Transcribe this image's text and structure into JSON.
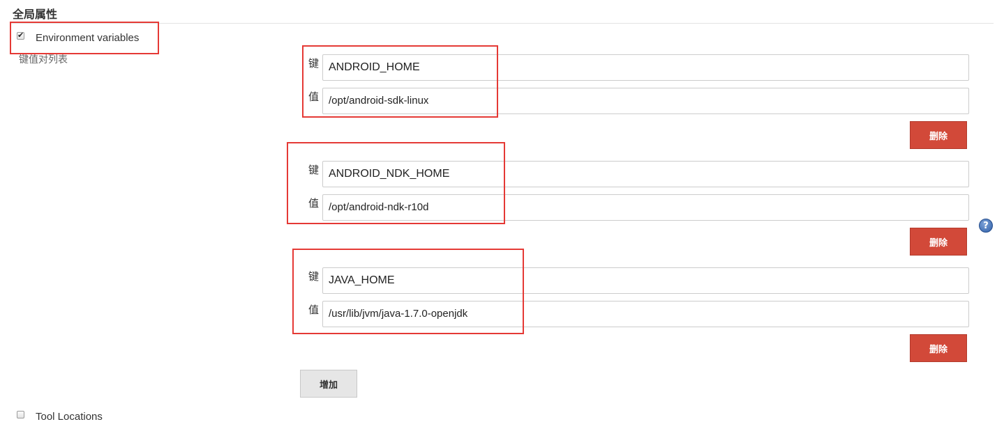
{
  "section": {
    "title": "全局属性"
  },
  "env_vars": {
    "label": "Environment variables",
    "checked": true,
    "list_label": "键值对列表",
    "key_label": "键",
    "value_label": "值",
    "delete_label": "删除",
    "add_label": "增加",
    "entries": [
      {
        "key": "ANDROID_HOME",
        "value": "/opt/android-sdk-linux"
      },
      {
        "key": "ANDROID_NDK_HOME",
        "value": "/opt/android-ndk-r10d"
      },
      {
        "key": "JAVA_HOME",
        "value": "/usr/lib/jvm/java-1.7.0-openjdk"
      }
    ]
  },
  "tool_locations": {
    "label": "Tool Locations",
    "checked": false
  },
  "help": {
    "icon": "help-icon",
    "glyph": "?"
  },
  "colors": {
    "delete_button": "#d24939",
    "highlight_box": "#e53935",
    "help_icon": "#2f5fa8"
  }
}
